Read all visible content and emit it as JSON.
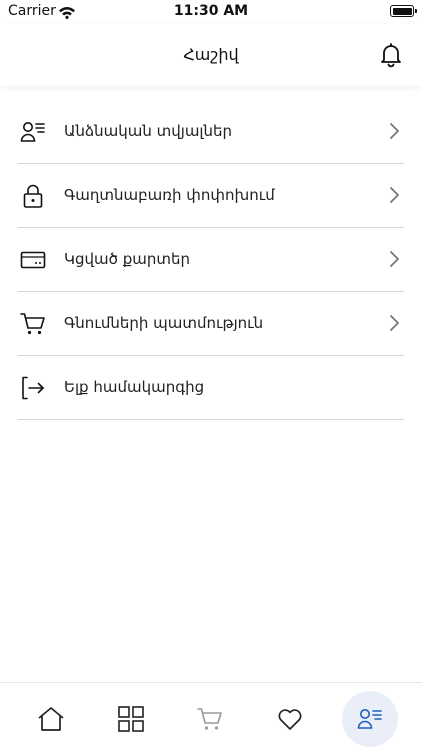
{
  "status_bar": {
    "carrier": "Carrier",
    "time": "11:30 AM"
  },
  "header": {
    "title": "Հաշիվ",
    "notification_icon": "bell-icon"
  },
  "menu": {
    "items": [
      {
        "label": "Անձնական տվյալներ",
        "icon": "user-list-icon",
        "has_chevron": true
      },
      {
        "label": "Գաղտնաբառի փոփոխում",
        "icon": "lock-icon",
        "has_chevron": true
      },
      {
        "label": "Կցված քարտեր",
        "icon": "card-icon",
        "has_chevron": true
      },
      {
        "label": "Գնումների պատմություն",
        "icon": "cart-icon",
        "has_chevron": true
      },
      {
        "label": "Ելք համակարգից",
        "icon": "logout-icon",
        "has_chevron": false
      }
    ]
  },
  "tab_bar": {
    "tabs": [
      {
        "icon": "home-icon",
        "active": false
      },
      {
        "icon": "grid-icon",
        "active": false
      },
      {
        "icon": "cart-icon",
        "active": false
      },
      {
        "icon": "heart-icon",
        "active": false
      },
      {
        "icon": "account-icon",
        "active": true
      }
    ],
    "active_color": "#1f5fbf",
    "active_background": "#e9eef8"
  }
}
